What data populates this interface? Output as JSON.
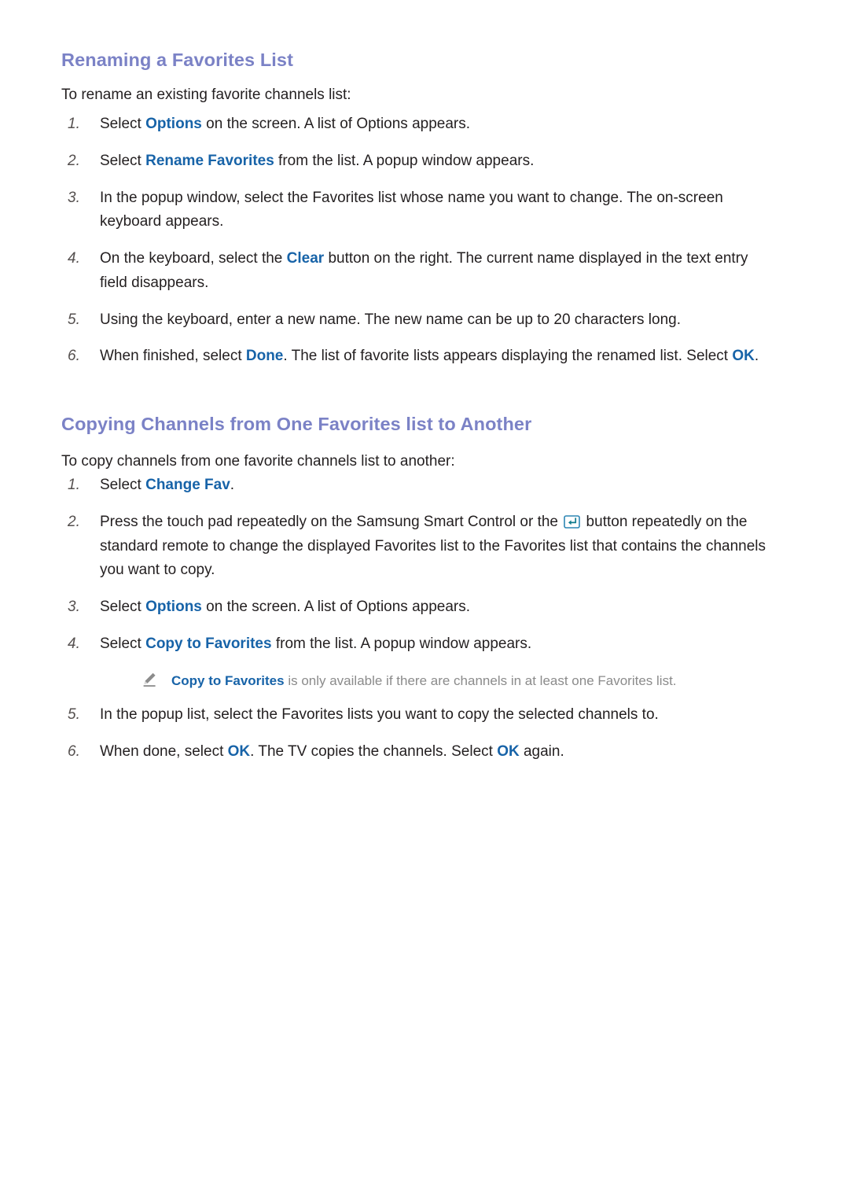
{
  "document": {
    "sections": [
      {
        "id": "renaming-favorites-list",
        "title": "Renaming a Favorites List",
        "intro": "To rename an existing favorite channels list:",
        "steps": [
          {
            "number": "1.",
            "parts": [
              {
                "t": "Select ",
                "k": "plain"
              },
              {
                "t": "Options",
                "k": "link"
              },
              {
                "t": " on the screen. A list of Options appears.",
                "k": "plain"
              }
            ]
          },
          {
            "number": "2.",
            "parts": [
              {
                "t": "Select ",
                "k": "plain"
              },
              {
                "t": "Rename Favorites",
                "k": "link"
              },
              {
                "t": " from the list. A popup window appears.",
                "k": "plain"
              }
            ]
          },
          {
            "number": "3.",
            "parts": [
              {
                "t": "In the popup window, select the Favorites list whose name you want to change. The on-screen keyboard appears.",
                "k": "plain"
              }
            ]
          },
          {
            "number": "4.",
            "parts": [
              {
                "t": "On the keyboard, select the ",
                "k": "plain"
              },
              {
                "t": "Clear",
                "k": "link"
              },
              {
                "t": " button on the right. The current name displayed in the text entry field disappears.",
                "k": "plain"
              }
            ]
          },
          {
            "number": "5.",
            "parts": [
              {
                "t": "Using the keyboard, enter a new name. The new name can be up to 20 characters long.",
                "k": "plain"
              }
            ]
          },
          {
            "number": "6.",
            "parts": [
              {
                "t": "When finished, select ",
                "k": "plain"
              },
              {
                "t": "Done",
                "k": "link"
              },
              {
                "t": ". The list of favorite lists appears displaying the renamed list. Select ",
                "k": "plain"
              },
              {
                "t": "OK",
                "k": "link"
              },
              {
                "t": ".",
                "k": "plain"
              }
            ]
          }
        ]
      },
      {
        "id": "copying-channels",
        "title": "Copying Channels from One Favorites list to Another",
        "intro": "To copy channels from one favorite channels list to another:",
        "steps": [
          {
            "number": "1.",
            "parts": [
              {
                "t": "Select ",
                "k": "plain"
              },
              {
                "t": "Change Fav",
                "k": "link"
              },
              {
                "t": ".",
                "k": "plain"
              }
            ]
          },
          {
            "number": "2.",
            "parts": [
              {
                "t": "Press the touch pad repeatedly on the Samsung Smart Control or the ",
                "k": "plain"
              },
              {
                "t": "enter-key-icon",
                "k": "icon"
              },
              {
                "t": " button repeatedly on the standard remote to change the displayed Favorites list to the Favorites list that contains the channels you want to copy.",
                "k": "plain"
              }
            ]
          },
          {
            "number": "3.",
            "parts": [
              {
                "t": "Select ",
                "k": "plain"
              },
              {
                "t": "Options",
                "k": "link"
              },
              {
                "t": " on the screen. A list of Options appears.",
                "k": "plain"
              }
            ]
          },
          {
            "number": "4.",
            "parts": [
              {
                "t": "Select ",
                "k": "plain"
              },
              {
                "t": "Copy to Favorites",
                "k": "link"
              },
              {
                "t": " from the list. A popup window appears.",
                "k": "plain"
              }
            ],
            "note": {
              "icon": "pencil-icon",
              "parts": [
                {
                  "t": "Copy to Favorites",
                  "k": "link"
                },
                {
                  "t": " is only available if there are channels in at least one Favorites list.",
                  "k": "plain"
                }
              ]
            }
          },
          {
            "number": "5.",
            "parts": [
              {
                "t": "In the popup list, select the Favorites lists you want to copy the selected channels to.",
                "k": "plain"
              }
            ]
          },
          {
            "number": "6.",
            "parts": [
              {
                "t": "When done, select ",
                "k": "plain"
              },
              {
                "t": "OK",
                "k": "link"
              },
              {
                "t": ". The TV copies the channels. Select ",
                "k": "plain"
              },
              {
                "t": "OK",
                "k": "link"
              },
              {
                "t": " again.",
                "k": "plain"
              }
            ]
          }
        ]
      }
    ]
  },
  "colors": {
    "heading": "#7b82c6",
    "link": "#1763a8",
    "body_text": "#231f20",
    "note_text": "#8b8b8b",
    "number": "#55504f",
    "icon_enter": "#1f7f96",
    "background": "#ffffff"
  }
}
